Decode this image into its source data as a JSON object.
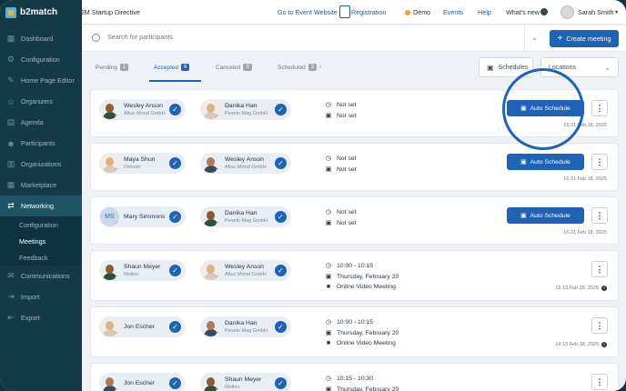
{
  "sidebar": {
    "logo": "b2match",
    "items": [
      {
        "label": "Dashboard",
        "icon": "dashboard-icon"
      },
      {
        "label": "Configuration",
        "icon": "gear-icon"
      },
      {
        "label": "Home Page Editor",
        "icon": "edit-icon"
      },
      {
        "label": "Organizers",
        "icon": "user-icon"
      },
      {
        "label": "Agenda",
        "icon": "calendar-icon"
      },
      {
        "label": "Participants",
        "icon": "users-icon"
      },
      {
        "label": "Organizations",
        "icon": "building-icon"
      },
      {
        "label": "Marketplace",
        "icon": "grid-icon"
      },
      {
        "label": "Networking",
        "icon": "handshake-icon"
      }
    ],
    "sub_items": [
      "Configuration",
      "Meetings",
      "Feedback"
    ],
    "bottom_items": [
      {
        "label": "Communications",
        "icon": "chat-icon"
      },
      {
        "label": "Import",
        "icon": "import-icon"
      },
      {
        "label": "Export",
        "icon": "export-icon"
      }
    ]
  },
  "topbar": {
    "event_name": "B2M Startup Directive",
    "go_to_event": "Go to Event Website",
    "registration": "Registration",
    "demo": "Demo",
    "events": "Events",
    "help": "Help",
    "whats_new": "What's new",
    "user": "Sarah Smith"
  },
  "search": {
    "placeholder": "Search for participants",
    "create_label": "Create meeting"
  },
  "tabs": [
    {
      "label": "Pending",
      "count": "1"
    },
    {
      "label": "Accepted",
      "count": "6"
    },
    {
      "label": "Canceled",
      "count": "0"
    },
    {
      "label": "Scheduled",
      "count": "3"
    }
  ],
  "controls": {
    "schedules": "Schedules",
    "locations": "Locations"
  },
  "meetings": [
    {
      "p1": {
        "name": "Wesley Anson",
        "org": "Altuc Mond GmbH"
      },
      "p2": {
        "name": "Danika Han",
        "org": "Pexels Mag GmbH"
      },
      "time": "Not set",
      "date": "Not set",
      "location": "",
      "button": "Auto Schedule",
      "stamp": "16:31 Feb 18, 2025"
    },
    {
      "p1": {
        "name": "Maya Shun",
        "org": "Orloom"
      },
      "p2": {
        "name": "Wesley Anson",
        "org": "Altuc Mond GmbH"
      },
      "time": "Not set",
      "date": "Not set",
      "location": "",
      "button": "Auto Schedule",
      "stamp": "16:31 Feb 18, 2025"
    },
    {
      "p1": {
        "name": "Mary Simmons",
        "org": "",
        "initials": "MS"
      },
      "p2": {
        "name": "Danika Han",
        "org": "Pexels Mag GmbH"
      },
      "time": "Not set",
      "date": "Not set",
      "location": "",
      "button": "Auto Schedule",
      "stamp": "16:31 Feb 18, 2025"
    },
    {
      "p1": {
        "name": "Shaun Meyer",
        "org": "Molino"
      },
      "p2": {
        "name": "Wesley Anson",
        "org": "Altuc Mond GmbH"
      },
      "time": "10:00 - 10:15",
      "date": "Thursday, February 20",
      "location": "Online Video Meeting",
      "button": "",
      "stamp": "16:13 Feb 18, 2025"
    },
    {
      "p1": {
        "name": "Jon Escher",
        "org": ""
      },
      "p2": {
        "name": "Danika Han",
        "org": "Pexels Mag GmbH"
      },
      "time": "10:00 - 10:15",
      "date": "Thursday, February 20",
      "location": "Online Video Meeting",
      "button": "",
      "stamp": "16:13 Feb 18, 2025"
    },
    {
      "p1": {
        "name": "Jon Escher",
        "org": ""
      },
      "p2": {
        "name": "Shaun Meyer",
        "org": "Molino"
      },
      "time": "10:15 - 10:30",
      "date": "Thursday, February 20",
      "location": "",
      "button": "",
      "stamp": ""
    }
  ],
  "colors": {
    "accent": "#1e63b5",
    "sidebar": "#143a48",
    "demo_dot": "#f0a030"
  }
}
